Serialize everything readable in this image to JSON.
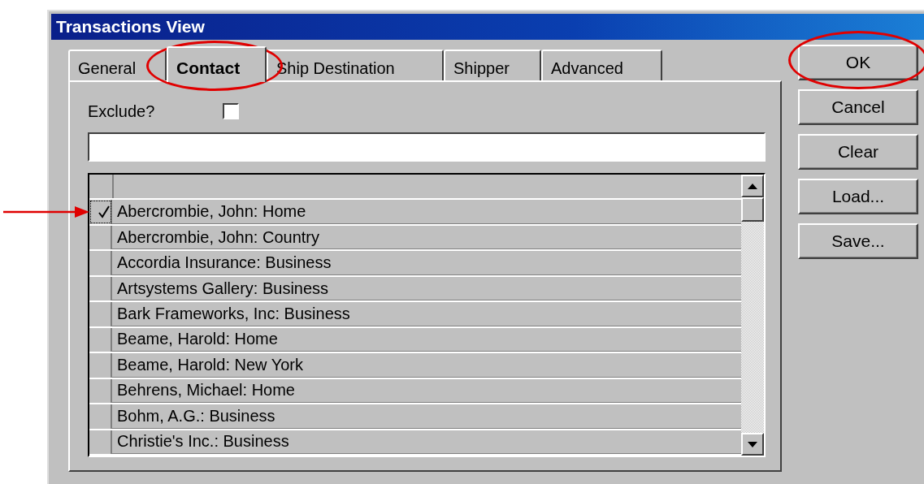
{
  "window": {
    "title": "Transactions View"
  },
  "tabs": [
    {
      "label": "General",
      "selected": false
    },
    {
      "label": "Contact",
      "selected": true
    },
    {
      "label": "Ship Destination",
      "selected": false
    },
    {
      "label": "Shipper",
      "selected": false
    },
    {
      "label": "Advanced",
      "selected": false
    }
  ],
  "exclude": {
    "label": "Exclude?",
    "checked": false
  },
  "contacts": [
    {
      "label": "Abercrombie, John: Home",
      "checked": true
    },
    {
      "label": "Abercrombie, John: Country",
      "checked": false
    },
    {
      "label": "Accordia Insurance: Business",
      "checked": false
    },
    {
      "label": "Artsystems Gallery: Business",
      "checked": false
    },
    {
      "label": "Bark Frameworks, Inc: Business",
      "checked": false
    },
    {
      "label": "Beame, Harold: Home",
      "checked": false
    },
    {
      "label": "Beame, Harold: New York",
      "checked": false
    },
    {
      "label": "Behrens, Michael: Home",
      "checked": false
    },
    {
      "label": "Bohm, A.G.: Business",
      "checked": false
    },
    {
      "label": "Christie's Inc.: Business",
      "checked": false
    }
  ],
  "buttons": [
    "OK",
    "Cancel",
    "Clear",
    "Load...",
    "Save..."
  ]
}
